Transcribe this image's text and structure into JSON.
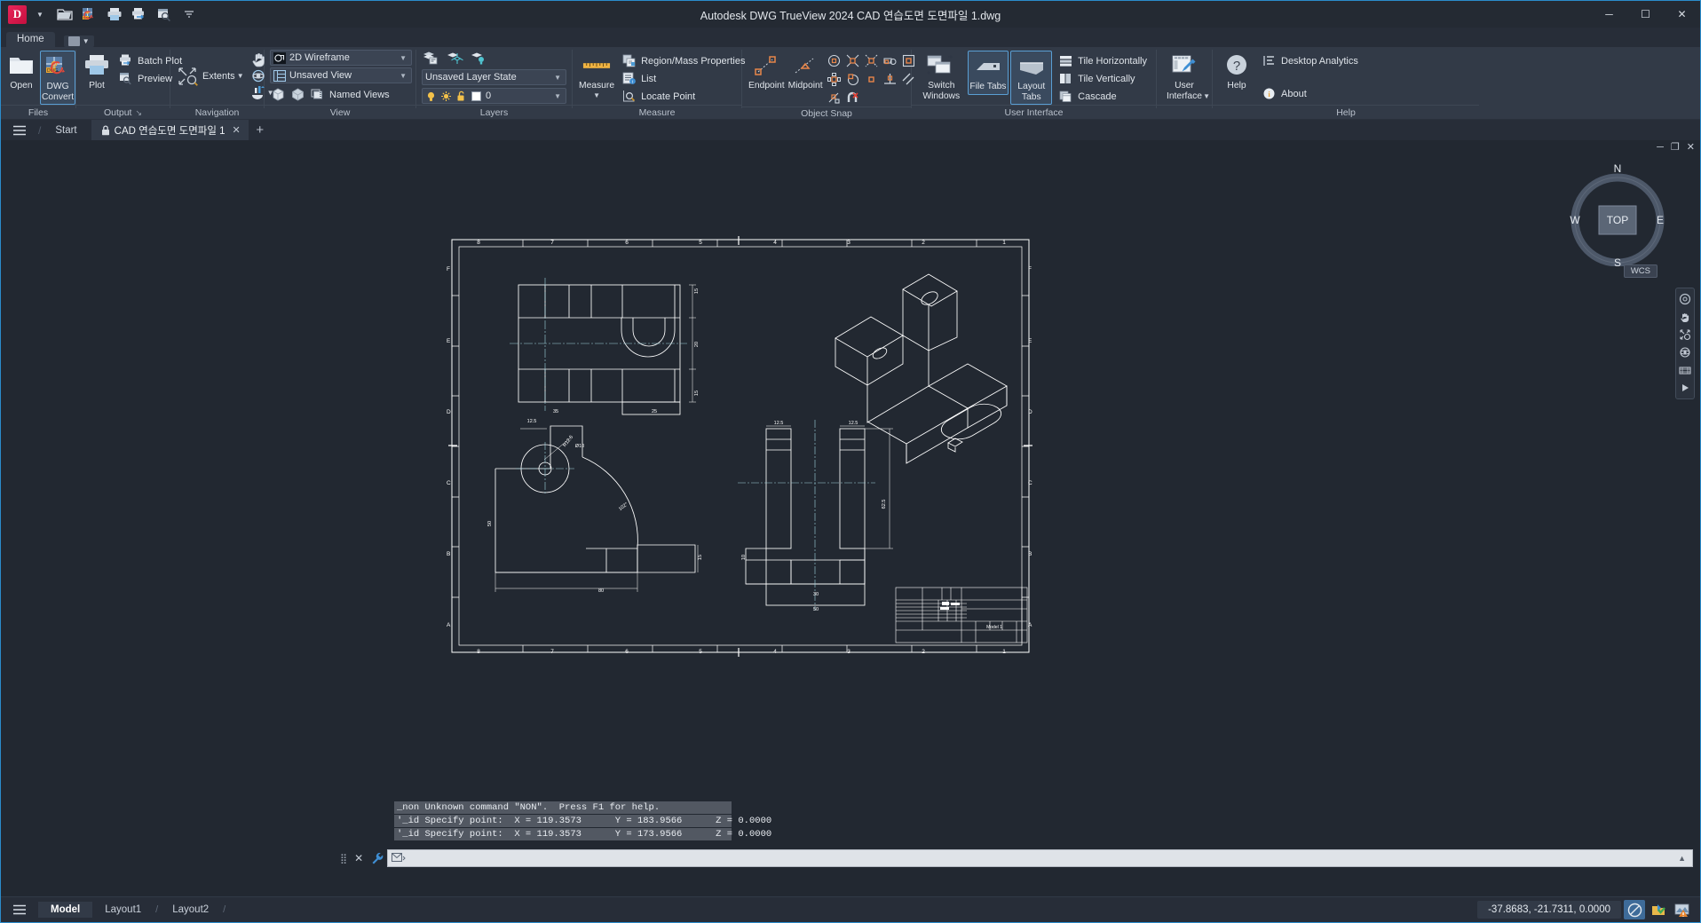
{
  "window": {
    "title": "Autodesk DWG TrueView 2024   CAD 연습도면 도면파일 1.dwg",
    "minimize": "─",
    "maximize": "☐",
    "close": "✕",
    "logo_letter": "D"
  },
  "quick_access": {
    "items": [
      {
        "name": "app-menu-dropdown",
        "icon": "chevron-down-icon"
      },
      {
        "name": "open-icon",
        "icon": "folder-open-icon"
      },
      {
        "name": "dwg-convert-icon",
        "icon": "dwg-convert-icon"
      },
      {
        "name": "plot-icon",
        "icon": "printer-icon"
      },
      {
        "name": "batch-plot-icon",
        "icon": "batch-print-icon"
      },
      {
        "name": "preview-icon",
        "icon": "print-preview-icon"
      },
      {
        "name": "qat-overflow",
        "icon": "chevron-down-icon"
      }
    ]
  },
  "ribbon": {
    "tabs": [
      {
        "label": "Home",
        "active": true
      }
    ],
    "panels": [
      {
        "name": "files",
        "label": "Files",
        "big_buttons": [
          {
            "label": "Open",
            "icon": "folder-open-icon"
          },
          {
            "label": "DWG\nConvert",
            "line1": "DWG",
            "line2": "Convert",
            "icon": "dwg-convert-icon",
            "active": true
          }
        ]
      },
      {
        "name": "output",
        "label": "Output",
        "dialog_launcher": true,
        "big_buttons": [
          {
            "label": "Plot",
            "icon": "printer-icon"
          }
        ],
        "small_rows": [
          {
            "label": "Batch Plot",
            "icon": "batch-print-icon"
          },
          {
            "label": "Preview",
            "icon": "print-preview-icon"
          }
        ]
      },
      {
        "name": "navigation",
        "label": "Navigation",
        "big_buttons": [
          {
            "label": "Extents",
            "icon": "zoom-extents-icon",
            "has_dropdown": true
          }
        ],
        "small_icons": [
          {
            "name": "pan-icon"
          },
          {
            "name": "orbit-icon"
          },
          {
            "name": "showmotion-icon",
            "has_dropdown": true
          }
        ]
      },
      {
        "name": "view",
        "label": "View",
        "combos": [
          {
            "name": "visual-style-combo",
            "value": "2D Wireframe",
            "icon": "visual-style-icon"
          },
          {
            "name": "view-combo",
            "value": "Unsaved View",
            "icon": "view-icon"
          }
        ],
        "small_icons": [
          {
            "name": "box-icon"
          },
          {
            "name": "sphere-icon"
          }
        ],
        "small_rows": [
          {
            "label": "Named Views",
            "icon": "named-views-icon"
          }
        ]
      },
      {
        "name": "layers",
        "label": "Layers",
        "combos": [
          {
            "name": "layer-state-combo",
            "value": "Unsaved Layer State"
          },
          {
            "name": "layer-combo",
            "value": "0",
            "has_layer_icons": true
          }
        ],
        "small_icons": [
          {
            "name": "layer-properties-icon"
          },
          {
            "name": "layer-freeze-icon"
          },
          {
            "name": "layer-off-icon"
          }
        ]
      },
      {
        "name": "measure",
        "label": "Measure",
        "big_buttons": [
          {
            "label": "Measure",
            "icon": "ruler-icon",
            "has_dropdown": true
          }
        ],
        "small_rows": [
          {
            "label": "Region/Mass Properties",
            "icon": "region-mass-icon"
          },
          {
            "label": "List",
            "icon": "list-icon"
          },
          {
            "label": "Locate Point",
            "icon": "locate-point-icon"
          }
        ]
      },
      {
        "name": "object-snap",
        "label": "Object Snap",
        "big_buttons": [
          {
            "label": "Endpoint",
            "icon": "endpoint-snap-icon"
          },
          {
            "label": "Midpoint",
            "icon": "midpoint-snap-icon"
          }
        ],
        "snap_icons": [
          "center-snap-icon",
          "intersection-snap-icon",
          "apparent-intersection-snap-icon",
          "extension-snap-icon",
          "insertion-snap-icon",
          "node-snap-icon",
          "quadrant-snap-icon",
          "nearest-snap-icon",
          "perpendicular-snap-icon",
          "parallel-snap-icon",
          "tangent-snap-icon",
          "none-snap-icon"
        ]
      },
      {
        "name": "user-interface",
        "label": "User Interface",
        "big_buttons": [
          {
            "label": "Switch\nWindows",
            "line1": "Switch",
            "line2": "Windows",
            "icon": "switch-windows-icon",
            "has_dropdown": true
          },
          {
            "label": "File Tabs",
            "line1": "File",
            "line2": "Tabs",
            "icon": "file-tabs-icon",
            "active": true
          },
          {
            "label": "Layout Tabs",
            "line1": "Layout",
            "line2": "Tabs",
            "icon": "layout-tabs-icon",
            "active": true
          }
        ],
        "small_rows": [
          {
            "label": "Tile Horizontally",
            "icon": "tile-horizontal-icon"
          },
          {
            "label": "Tile Vertically",
            "icon": "tile-vertical-icon"
          },
          {
            "label": "Cascade",
            "icon": "cascade-icon"
          }
        ]
      },
      {
        "name": "user-interface-2",
        "label": "",
        "big_buttons": [
          {
            "label": "User\nInterface",
            "line1": "User",
            "line2": "Interface",
            "icon": "user-interface-icon",
            "has_dropdown": true
          }
        ]
      },
      {
        "name": "help",
        "label": "Help",
        "big_buttons": [
          {
            "label": "Help",
            "icon": "help-icon"
          }
        ],
        "small_rows": [
          {
            "label": "Desktop Analytics",
            "icon": "desktop-analytics-icon"
          },
          {
            "label": "About",
            "icon": "info-icon"
          }
        ]
      }
    ]
  },
  "file_tabs": {
    "menu_icon": "hamburger-icon",
    "start_label": "Start",
    "documents": [
      {
        "label": "CAD 연습도면 도면파일 1",
        "locked": true,
        "active": true,
        "close": "✕"
      }
    ],
    "new_tab": "+"
  },
  "drawing": {
    "doc_window_controls": {
      "minimize": "─",
      "restore": "❐",
      "close": "✕"
    },
    "viewcube": {
      "face": "TOP",
      "north": "N",
      "east": "E",
      "south": "S",
      "west": "W"
    },
    "wcs_label": "WCS",
    "sheet": {
      "title_block_label": "Model 1",
      "column_labels_top": [
        "8",
        "7",
        "6",
        "5",
        "4",
        "3",
        "2",
        "1"
      ],
      "column_labels_bottom": [
        "8",
        "7",
        "6",
        "5",
        "4",
        "3",
        "2",
        "1"
      ],
      "row_labels": [
        "F",
        "E",
        "D",
        "C",
        "B",
        "A"
      ]
    },
    "dimensions": {
      "top_view": [
        "15",
        "20",
        "15",
        "35",
        "25"
      ],
      "front_view": [
        "12.5",
        "R12.5",
        "Ø10",
        "102°",
        "50",
        "80",
        "15"
      ],
      "side_view": [
        "12.5",
        "12.5",
        "62.5",
        "10",
        "30",
        "50"
      ]
    }
  },
  "command_line": {
    "history": [
      "_non Unknown command \"NON\".  Press F1 for help.",
      "'_id Specify point:  X = 119.3573      Y = 183.9566      Z = 0.0000",
      "'_id Specify point:  X = 119.3573      Y = 173.9566      Z = 0.0000"
    ],
    "input_value": "",
    "input_placeholder": "",
    "grip_icon": "drag-grip-icon",
    "close_icon": "close-icon",
    "customize_icon": "wrench-icon",
    "prompt_icon": "command-prompt-icon",
    "scroll_icon": "scroll-up-icon"
  },
  "status_bar": {
    "menu_icon": "hamburger-icon",
    "layout_tabs": [
      {
        "label": "Model",
        "active": true
      },
      {
        "label": "Layout1",
        "active": false
      },
      {
        "label": "Layout2",
        "active": false
      }
    ],
    "coordinates": "-37.8683, -21.7311, 0.0000",
    "right_icons": [
      {
        "name": "no-selection-icon",
        "on": true
      },
      {
        "name": "isolate-objects-icon",
        "on": false
      },
      {
        "name": "graphics-warning-icon",
        "on": false
      }
    ]
  },
  "colors": {
    "accent": "#5a9fd4",
    "ribbon_bg": "#323a47",
    "titlebar_bg": "#242a33",
    "canvas_bg": "#222831",
    "drawing_stroke": "#ffffff",
    "brand_red": "#e8255a"
  }
}
